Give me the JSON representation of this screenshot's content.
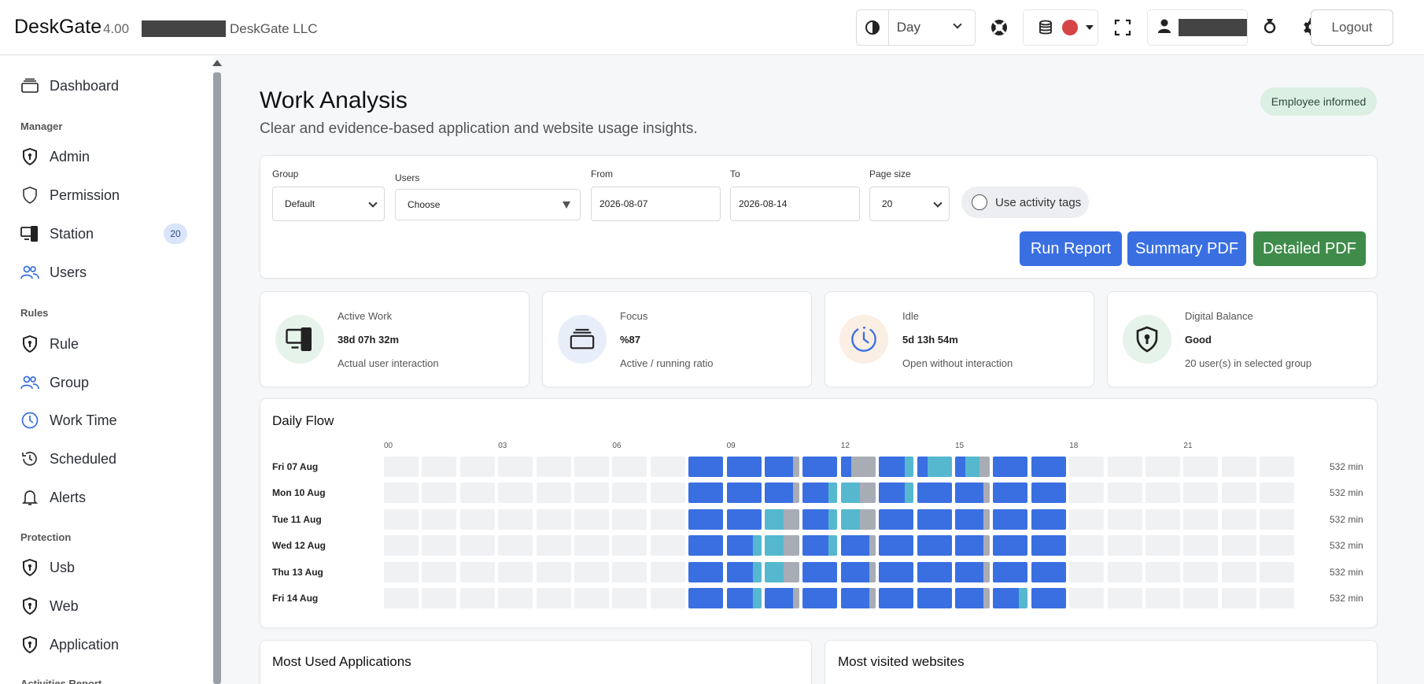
{
  "header": {
    "brand": "DeskGate",
    "version": "4.00",
    "company": "DeskGate LLC",
    "view_select": "Day",
    "logout_label": "Logout",
    "status_dot_color": "#d64545"
  },
  "sidebar": {
    "items": [
      {
        "label": "Dashboard",
        "icon": "layers-icon"
      },
      {
        "section": "Manager"
      },
      {
        "label": "Admin",
        "icon": "shield-icon"
      },
      {
        "label": "Permission",
        "icon": "shield-outline-icon"
      },
      {
        "label": "Station",
        "icon": "devices-icon",
        "badge": "20"
      },
      {
        "label": "Users",
        "icon": "users-icon"
      },
      {
        "section": "Rules"
      },
      {
        "label": "Rule",
        "icon": "shield-icon"
      },
      {
        "label": "Group",
        "icon": "users-icon"
      },
      {
        "label": "Work Time",
        "icon": "clock-icon"
      },
      {
        "label": "Scheduled",
        "icon": "history-icon"
      },
      {
        "label": "Alerts",
        "icon": "bell-icon"
      },
      {
        "section": "Protection"
      },
      {
        "label": "Usb",
        "icon": "shield-icon"
      },
      {
        "label": "Web",
        "icon": "shield-icon"
      },
      {
        "label": "Application",
        "icon": "shield-icon"
      },
      {
        "section": "Activities Report"
      }
    ]
  },
  "main": {
    "title": "Work Analysis",
    "subtitle": "Clear and evidence-based application and website usage insights.",
    "informed_badge": "Employee informed",
    "filters": {
      "group_label": "Group",
      "group_value": "Default",
      "users_label": "Users",
      "users_value": "Choose",
      "from_label": "From",
      "from_value": "2026-08-07",
      "to_label": "To",
      "to_value": "2026-08-14",
      "page_size_label": "Page size",
      "page_size_value": "20",
      "tags_label": "Use activity tags"
    },
    "buttons": {
      "run": "Run Report",
      "summary": "Summary PDF",
      "detailed": "Detailed PDF"
    },
    "stats": [
      {
        "label": "Active Work",
        "value": "38d 07h 32m",
        "sub": "Actual user interaction",
        "icon": "devices-icon"
      },
      {
        "label": "Focus",
        "value": "%87",
        "sub": "Active / running ratio",
        "icon": "layers-icon"
      },
      {
        "label": "Idle",
        "value": "5d 13h 54m",
        "sub": "Open without interaction",
        "icon": "clock-icon"
      },
      {
        "label": "Digital Balance",
        "value": "Good",
        "sub": "20 user(s) in selected group",
        "icon": "shield-lock-icon"
      }
    ],
    "daily_flow": {
      "title": "Daily Flow",
      "hours": [
        "00",
        "03",
        "06",
        "09",
        "12",
        "15",
        "18",
        "21"
      ],
      "colors": {
        "active": "#3a6fe2",
        "focus": "#55b8cf",
        "idle": "#a8adb5",
        "off": "#f0f1f3"
      },
      "rows": [
        {
          "day": "Fri 07 Aug",
          "minutes": "532 min",
          "cells": {
            "8": "A",
            "9": "A",
            "10": "AI",
            "11": "A",
            "12": "AII",
            "13": "AF",
            "14": "AFF",
            "15": "AFI",
            "16": "A",
            "17": "A"
          }
        },
        {
          "day": "Mon 10 Aug",
          "minutes": "532 min",
          "cells": {
            "8": "A",
            "9": "A",
            "10": "AI",
            "11": "AF",
            "12": "FI",
            "13": "AF",
            "14": "A",
            "15": "AI",
            "16": "A",
            "17": "A"
          }
        },
        {
          "day": "Tue 11 Aug",
          "minutes": "532 min",
          "cells": {
            "8": "A",
            "9": "A",
            "10": "FI",
            "11": "AF",
            "12": "FI",
            "13": "A",
            "14": "A",
            "15": "AI",
            "16": "A",
            "17": "A"
          }
        },
        {
          "day": "Wed 12 Aug",
          "minutes": "532 min",
          "cells": {
            "8": "A",
            "9": "AF",
            "10": "FI",
            "11": "AF",
            "12": "AI",
            "13": "A",
            "14": "A",
            "15": "AI",
            "16": "A",
            "17": "A"
          }
        },
        {
          "day": "Thu 13 Aug",
          "minutes": "532 min",
          "cells": {
            "8": "A",
            "9": "AF",
            "10": "FI",
            "11": "A",
            "12": "AI",
            "13": "A",
            "14": "A",
            "15": "AI",
            "16": "A",
            "17": "A"
          }
        },
        {
          "day": "Fri 14 Aug",
          "minutes": "532 min",
          "cells": {
            "8": "A",
            "9": "AF",
            "10": "AI",
            "11": "A",
            "12": "AI",
            "13": "A",
            "14": "A",
            "15": "AI",
            "16": "AF",
            "17": "A"
          }
        }
      ]
    },
    "panels": {
      "apps": "Most Used Applications",
      "websites": "Most visited websites"
    }
  }
}
